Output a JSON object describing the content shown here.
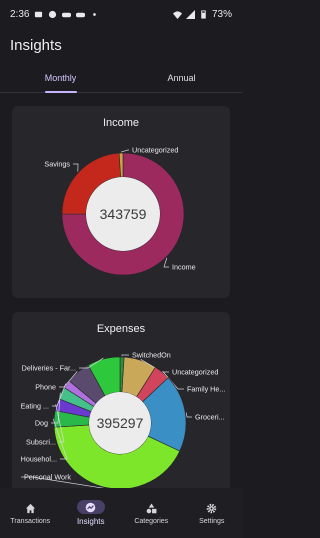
{
  "status": {
    "time": "2:36",
    "battery": "73%"
  },
  "app": {
    "title": "Insights"
  },
  "tabs": [
    {
      "label": "Monthly",
      "active": true
    },
    {
      "label": "Annual",
      "active": false
    }
  ],
  "income": {
    "title": "Income",
    "total": "343759",
    "chart_data": {
      "type": "pie",
      "slices": [
        {
          "label": "Income",
          "value": 75,
          "color": "#9c2a5e"
        },
        {
          "label": "Savings",
          "value": 24,
          "color": "#c4281c"
        },
        {
          "label": "Uncategorized",
          "value": 1,
          "color": "#c9a348"
        }
      ]
    }
  },
  "expenses": {
    "title": "Expenses",
    "total": "395297",
    "chart_data": {
      "type": "pie",
      "slices": [
        {
          "label": "SwitchedOn",
          "value": 1,
          "color": "#2f8f3a"
        },
        {
          "label": "Uncategorized",
          "value": 8,
          "color": "#c9a85a"
        },
        {
          "label": "Family He...",
          "value": 4,
          "color": "#d0455b"
        },
        {
          "label": "Groceri...",
          "value": 19,
          "color": "#3a8fc4"
        },
        {
          "label": "Personal Work",
          "value": 42,
          "color": "#7ee62a"
        },
        {
          "label": "Househol...",
          "value": 4,
          "color": "#2bb84a"
        },
        {
          "label": "Subscri...",
          "value": 3,
          "color": "#6a3ad0"
        },
        {
          "label": "Dog",
          "value": 3,
          "color": "#45c08a"
        },
        {
          "label": "Eating ...",
          "value": 2,
          "color": "#b070e0"
        },
        {
          "label": "Phone",
          "value": 6,
          "color": "#5a4a6e"
        },
        {
          "label": "Deliveries - Far...",
          "value": 8,
          "color": "#2ec83c"
        }
      ]
    }
  },
  "nav": [
    {
      "label": "Transactions",
      "icon": "home-icon",
      "active": false
    },
    {
      "label": "Insights",
      "icon": "insights-icon",
      "active": true
    },
    {
      "label": "Categories",
      "icon": "categories-icon",
      "active": false
    },
    {
      "label": "Settings",
      "icon": "gear-icon",
      "active": false
    }
  ]
}
